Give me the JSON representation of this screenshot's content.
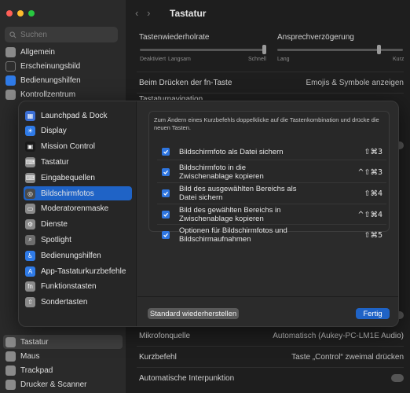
{
  "background": {
    "search_placeholder": "Suchen",
    "sidebar_top": [
      "Allgemein",
      "Erscheinungsbild",
      "Bedienungshilfen",
      "Kontrollzentrum"
    ],
    "sidebar_bottom": [
      "Tastatur",
      "Maus",
      "Trackpad",
      "Drucker & Scanner"
    ],
    "title": "Tastatur",
    "repeat_label": "Tastenwiederholrate",
    "delay_label": "Ansprechverzögerung",
    "repeat_min": "Deaktiviert",
    "repeat_slow": "Langsam",
    "repeat_fast": "Schnell",
    "delay_long": "Lang",
    "delay_short": "Kurz",
    "fn_label": "Beim Drücken der fn-Taste",
    "fn_value": "Emojis & Symbole anzeigen",
    "partial_label": "Tastaturnavigation",
    "mic_label": "Mikrofonquelle",
    "mic_value": "Automatisch (Aukey-PC-LM1E Audio)",
    "shortcut_label": "Kurzbefehl",
    "shortcut_value": "Taste „Control“ zweimal drücken",
    "auto_punct_label": "Automatische Interpunktion"
  },
  "sheet": {
    "categories": [
      {
        "label": "Launchpad & Dock",
        "icon": "launchpad-icon",
        "color": "#3b6fd6"
      },
      {
        "label": "Display",
        "icon": "display-icon",
        "color": "#2f7be8"
      },
      {
        "label": "Mission Control",
        "icon": "mission-control-icon",
        "color": "#1a1a1a"
      },
      {
        "label": "Tastatur",
        "icon": "keyboard-icon",
        "color": "#8a8a8a"
      },
      {
        "label": "Eingabequellen",
        "icon": "input-sources-icon",
        "color": "#8a8a8a"
      },
      {
        "label": "Bildschirmfotos",
        "icon": "screenshot-icon",
        "color": "#4a4a4a"
      },
      {
        "label": "Moderatorenmaske",
        "icon": "presenter-overlay-icon",
        "color": "#8a8a8a"
      },
      {
        "label": "Dienste",
        "icon": "gear-icon",
        "color": "#8a8a8a"
      },
      {
        "label": "Spotlight",
        "icon": "spotlight-icon",
        "color": "#6e6e6e"
      },
      {
        "label": "Bedienungshilfen",
        "icon": "accessibility-icon",
        "color": "#2f7be8"
      },
      {
        "label": "App-Tastaturkurzbefehle",
        "icon": "app-shortcuts-icon",
        "color": "#2f7be8"
      },
      {
        "label": "Funktionstasten",
        "icon": "fn-icon",
        "color": "#8a8a8a"
      },
      {
        "label": "Sondertasten",
        "icon": "modifier-keys-icon",
        "color": "#8a8a8a"
      }
    ],
    "selected_index": 5,
    "description": "Zum Ändern eines Kurzbefehls doppelklicke auf die Tastenkombination und drücke die neuen Tasten.",
    "shortcuts": [
      {
        "label": "Bildschirmfoto als Datei sichern",
        "keys": "⇧⌘3"
      },
      {
        "label": "Bildschirmfoto in die Zwischenablage kopieren",
        "keys": "^⇧⌘3"
      },
      {
        "label": "Bild des ausgewählten Bereichs als Datei sichern",
        "keys": "⇧⌘4"
      },
      {
        "label": "Bild des gewählten Bereichs in Zwischenablage kopieren",
        "keys": "^⇧⌘4"
      },
      {
        "label": "Optionen für Bildschirmfotos und Bildschirmaufnahmen",
        "keys": "⇧⌘5"
      }
    ],
    "restore_label": "Standard wiederherstellen",
    "done_label": "Fertig"
  },
  "colors": {
    "accent": "#1f63c6",
    "checkbox": "#2f76e0",
    "sheet_bg": "#2b2b2b"
  }
}
